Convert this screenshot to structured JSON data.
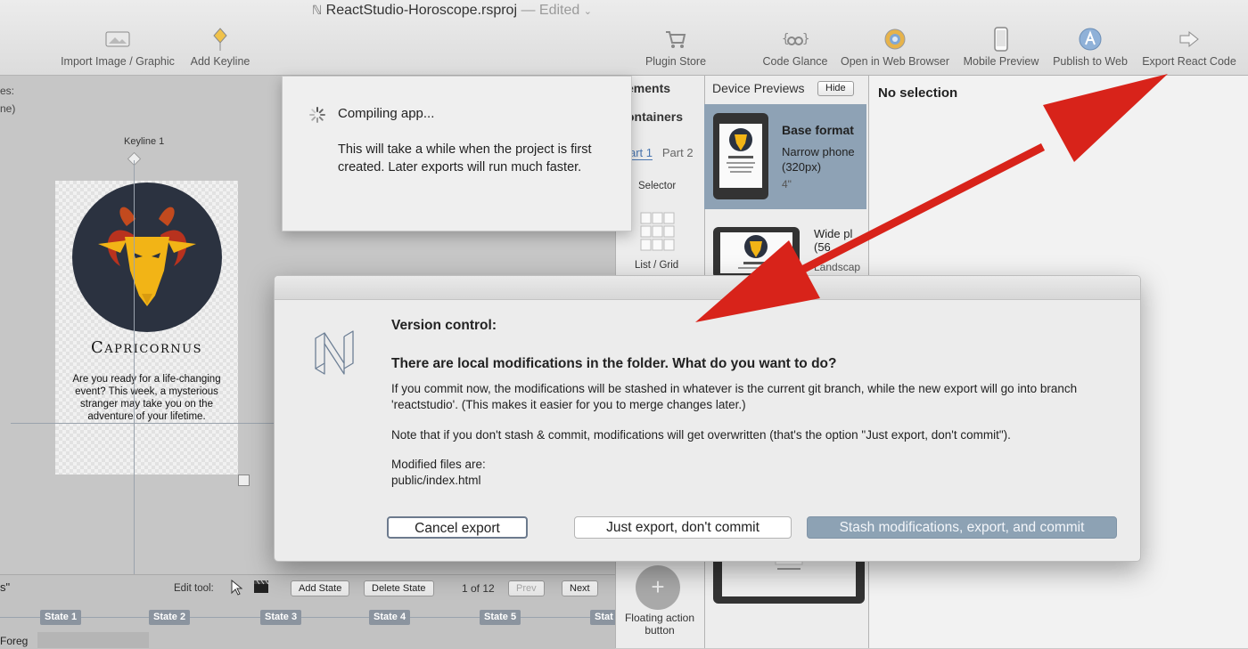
{
  "window": {
    "title": "ReactStudio-Horoscope.rsproj",
    "status": "— Edited"
  },
  "toolbar": {
    "left_buttons": [
      {
        "label": "Import Image / Graphic",
        "icon": "image-icon"
      },
      {
        "label": "Add Keyline",
        "icon": "keyline-icon"
      }
    ],
    "right_buttons": [
      {
        "label": "Plugin Store",
        "icon": "cart-icon"
      },
      {
        "label": "Code Glance",
        "icon": "binoculars-icon"
      },
      {
        "label": "Open in Web Browser",
        "icon": "browser-icon"
      },
      {
        "label": "Mobile Preview",
        "icon": "phone-icon"
      },
      {
        "label": "Publish to Web",
        "icon": "publish-icon"
      },
      {
        "label": "Export React Code",
        "icon": "export-arrow-icon"
      }
    ]
  },
  "canvas": {
    "side_label_1": "es:",
    "side_label_2": "ne)",
    "keyline_label": "Keyline 1",
    "card": {
      "name": "Capricornus",
      "text": "Are you ready for a life-changing event? This week, a mysterious stranger may take you on the adventure of your lifetime."
    }
  },
  "state_bar": {
    "tab_label": "s\"",
    "edit_tool_label": "Edit tool:",
    "add_state": "Add State",
    "delete_state": "Delete State",
    "page_info": "1 of 12",
    "prev": "Prev",
    "next": "Next",
    "states": [
      "State 1",
      "State 2",
      "State 3",
      "State 4",
      "State 5",
      "Stat"
    ],
    "foreground_label": "Foreg"
  },
  "elements_panel": {
    "elements_header": "ements",
    "containers_header": "ontainers",
    "tab_1": "art 1",
    "tab_2": "Part 2",
    "selector_label": "Selector",
    "list_grid_label": "List / Grid",
    "fab_symbol": "+",
    "fab_label": "Floating action button"
  },
  "device_previews": {
    "title": "Device Previews",
    "hide_button": "Hide",
    "base_title": "Base format",
    "base_desc_1": "Narrow phone",
    "base_desc_2": "(320px)",
    "base_size": "4\"",
    "wide_title": "Wide pl",
    "wide_desc": "(56",
    "landscape": "Landscap"
  },
  "inspector": {
    "no_selection": "No selection"
  },
  "compile_popup": {
    "title": "Compiling app...",
    "text": "This will take a while when the project is first created. Later exports will run much faster."
  },
  "version_dialog": {
    "heading": "Version control:",
    "question": "There are local modifications in the folder. What do you want to do?",
    "paragraph_1": "If you commit now, the modifications will be stashed in whatever is the current git branch, while the new export will go into branch 'reactstudio'. (This makes it easier for you to merge changes later.)",
    "paragraph_2": "Note that if you don't stash & commit, modifications will get overwritten (that's the option \"Just export, don't commit\").",
    "modified_label": "Modified files are:",
    "modified_file": "public/index.html",
    "buttons": {
      "cancel": "Cancel export",
      "just_export": "Just export, don't commit",
      "stash": "Stash modifications, export, and commit"
    }
  },
  "colors": {
    "annotation_arrow": "#d8231a",
    "selected_preview": "#8ea2b5",
    "goat": "#f2b416",
    "goat_circle": "#2b3240",
    "horns": "#b8321e"
  }
}
